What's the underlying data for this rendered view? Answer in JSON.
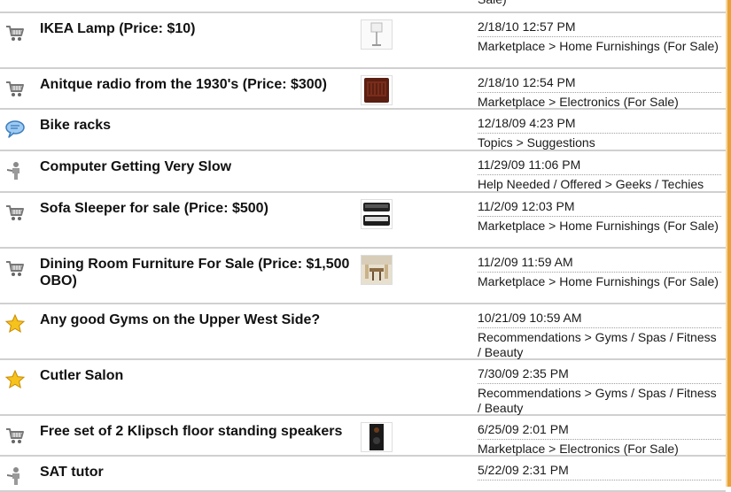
{
  "rows": [
    {
      "icon": "cart-icon",
      "title": "",
      "thumb": "",
      "date": "",
      "category": "Sale)",
      "height": 31
    },
    {
      "icon": "cart-icon",
      "title": "IKEA Lamp (Price: $10)",
      "thumb": "lamp-thumbnail",
      "date": "2/18/10 12:57 PM",
      "category": "Marketplace > Home Furnishings (For Sale)",
      "height": 63
    },
    {
      "icon": "cart-icon",
      "title": "Anitque radio from the 1930's (Price: $300)",
      "thumb": "radio-thumbnail",
      "date": "2/18/10 12:54 PM",
      "category": "Marketplace > Electronics (For Sale)",
      "height": 46
    },
    {
      "icon": "speech-bubble-icon",
      "title": "Bike racks",
      "thumb": "",
      "date": "12/18/09 4:23 PM",
      "category": "Topics > Suggestions",
      "height": 47
    },
    {
      "icon": "help-person-icon",
      "title": "Computer Getting Very Slow",
      "thumb": "",
      "date": "11/29/09 11:06 PM",
      "category": "Help Needed / Offered > Geeks / Techies",
      "height": 47
    },
    {
      "icon": "cart-icon",
      "title": "Sofa Sleeper for sale (Price: $500)",
      "thumb": "sofa-thumbnail",
      "date": "11/2/09 12:03 PM",
      "category": "Marketplace > Home Furnishings (For Sale)",
      "height": 63
    },
    {
      "icon": "cart-icon",
      "title": "Dining Room Furniture For Sale (Price: $1,500 OBO)",
      "thumb": "dining-thumbnail",
      "date": "11/2/09 11:59 AM",
      "category": "Marketplace > Home Furnishings (For Sale)",
      "height": 63
    },
    {
      "icon": "star-icon",
      "title": "Any good Gyms on the Upper West Side?",
      "thumb": "",
      "date": "10/21/09 10:59 AM",
      "category": "Recommendations > Gyms / Spas / Fitness / Beauty",
      "height": 63
    },
    {
      "icon": "star-icon",
      "title": "Cutler Salon",
      "thumb": "",
      "date": "7/30/09 2:35 PM",
      "category": "Recommendations > Gyms / Spas / Fitness / Beauty",
      "height": 63
    },
    {
      "icon": "cart-icon",
      "title": "Free set of 2 Klipsch floor standing speakers",
      "thumb": "speakers-thumbnail",
      "date": "6/25/09 2:01 PM",
      "category": "Marketplace > Electronics (For Sale)",
      "height": 46
    },
    {
      "icon": "help-person-icon",
      "title": "SAT tutor",
      "thumb": "",
      "date": "5/22/09 2:31 PM",
      "category": "",
      "height": 40
    }
  ],
  "colors": {
    "accent_border": "#e8a234",
    "row_divider": "#d0d0d0"
  }
}
